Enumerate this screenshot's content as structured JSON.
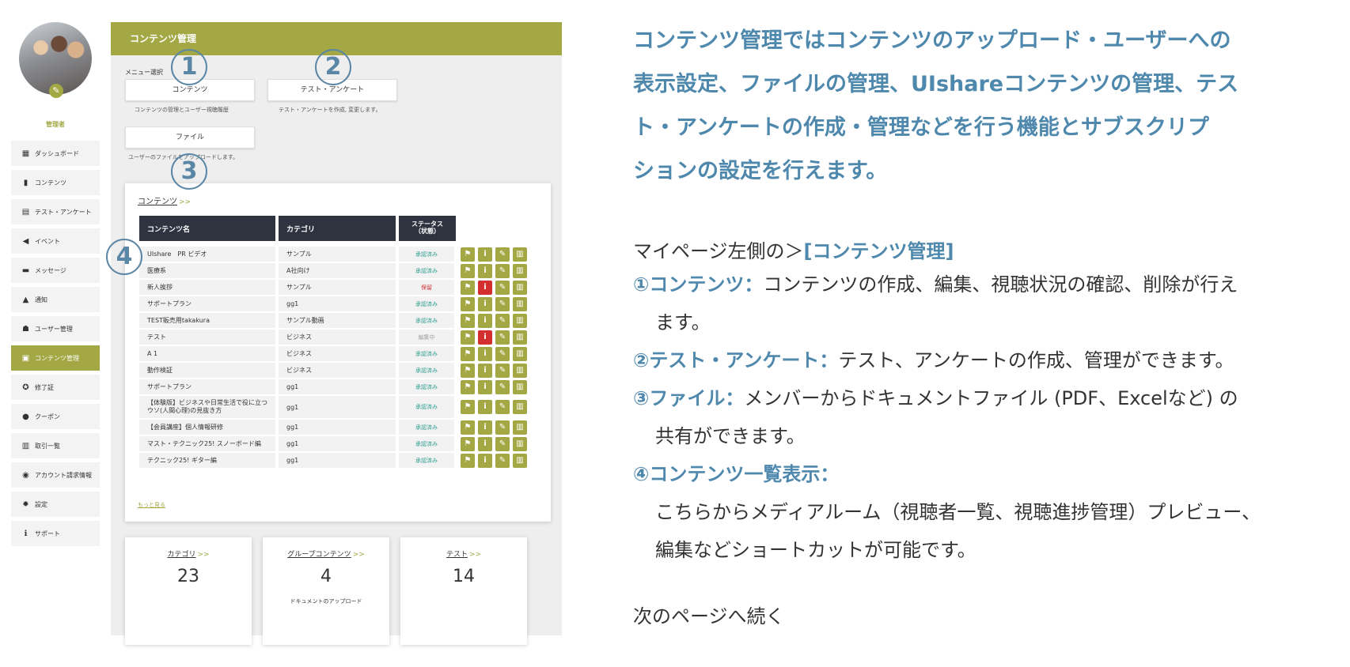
{
  "sidebar": {
    "role": "管理者",
    "items": [
      {
        "label": "ダッシュボード",
        "icon": "dashboard-icon",
        "glyph": "▦",
        "active": false
      },
      {
        "label": "コンテンツ",
        "icon": "book-icon",
        "glyph": "▮",
        "active": false
      },
      {
        "label": "テスト・アンケート",
        "icon": "test-icon",
        "glyph": "▤",
        "active": false
      },
      {
        "label": "イベント",
        "icon": "megaphone-icon",
        "glyph": "◀",
        "active": false
      },
      {
        "label": "メッセージ",
        "icon": "message-icon",
        "glyph": "▬",
        "active": false
      },
      {
        "label": "通知",
        "icon": "bell-icon",
        "glyph": "▲",
        "active": false
      },
      {
        "label": "ユーザー管理",
        "icon": "users-icon",
        "glyph": "☗",
        "active": false
      },
      {
        "label": "コンテンツ管理",
        "icon": "content-manage-icon",
        "glyph": "▣",
        "active": true
      },
      {
        "label": "修了証",
        "icon": "medal-icon",
        "glyph": "✪",
        "active": false
      },
      {
        "label": "クーポン",
        "icon": "coupon-icon",
        "glyph": "●",
        "active": false
      },
      {
        "label": "取引一覧",
        "icon": "transactions-icon",
        "glyph": "▥",
        "active": false
      },
      {
        "label": "アカウント請求情報",
        "icon": "billing-icon",
        "glyph": "◉",
        "active": false
      },
      {
        "label": "設定",
        "icon": "gear-icon",
        "glyph": "✹",
        "active": false
      },
      {
        "label": "サポート",
        "icon": "info-icon",
        "glyph": "ℹ",
        "active": false
      }
    ]
  },
  "panel": {
    "title": "コンテンツ管理",
    "menu_caption": "メニュー選択",
    "menu": {
      "contents": {
        "label": "コンテンツ",
        "desc": "コンテンツの管理とユーザー視聴履歴"
      },
      "test": {
        "label": "テスト・アンケート",
        "desc": "テスト・アンケートを作成, 変更します。"
      },
      "file": {
        "label": "ファイル",
        "desc": "ユーザーのファイルをアップロードします。"
      }
    },
    "content_card": {
      "title": "コンテンツ",
      "arrow": ">>",
      "headers": {
        "name": "コンテンツ名",
        "category": "カテゴリ",
        "status": "ステータス\n（状態）"
      },
      "more_label": "もっと見る"
    },
    "stats": [
      {
        "title": "カテゴリ",
        "value": "23",
        "sub": ""
      },
      {
        "title": "グループコンテンツ",
        "value": "4",
        "sub": "ドキュメントのアップロード"
      },
      {
        "title": "テスト",
        "value": "14",
        "sub": ""
      }
    ]
  },
  "rows": [
    {
      "name": "UIshare　PR ビデオ",
      "category": "サンプル",
      "status": "承認済み",
      "status_color": "#2a9d8f",
      "info_red": false
    },
    {
      "name": "医療系",
      "category": "A社向け",
      "status": "承認済み",
      "status_color": "#2a9d8f",
      "info_red": false
    },
    {
      "name": "新人挨拶",
      "category": "サンプル",
      "status": "保留",
      "status_color": "#d32f2f",
      "info_red": true
    },
    {
      "name": "サポートプラン",
      "category": "gg1",
      "status": "承認済み",
      "status_color": "#2a9d8f",
      "info_red": false
    },
    {
      "name": "TEST販売用takakura",
      "category": "サンプル動画",
      "status": "承認済み",
      "status_color": "#2a9d8f",
      "info_red": false
    },
    {
      "name": "テスト",
      "category": "ビジネス",
      "status": "編集中",
      "status_color": "#9e9e9e",
      "info_red": true
    },
    {
      "name": "A 1",
      "category": "ビジネス",
      "status": "承認済み",
      "status_color": "#2a9d8f",
      "info_red": false
    },
    {
      "name": "動作検証",
      "category": "ビジネス",
      "status": "承認済み",
      "status_color": "#2a9d8f",
      "info_red": false
    },
    {
      "name": "サポートプラン",
      "category": "gg1",
      "status": "承認済み",
      "status_color": "#2a9d8f",
      "info_red": false
    },
    {
      "name": "【体験版】ビジネスや日常生活で役に立つ　ウソ(人間心理)の見抜き方",
      "category": "gg1",
      "status": "承認済み",
      "status_color": "#2a9d8f",
      "info_red": false,
      "tall": true
    },
    {
      "name": "【会員講座】個人情報研修",
      "category": "gg1",
      "status": "承認済み",
      "status_color": "#2a9d8f",
      "info_red": false
    },
    {
      "name": "マスト・テクニック25! スノーボード編",
      "category": "gg1",
      "status": "承認済み",
      "status_color": "#2a9d8f",
      "info_red": false
    },
    {
      "name": "テクニック25! ギター編",
      "category": "gg1",
      "status": "承認済み",
      "status_color": "#2a9d8f",
      "info_red": false
    }
  ],
  "markers": [
    "1",
    "2",
    "3",
    "4"
  ],
  "explanation": {
    "lead_lines": [
      "コンテンツ管理ではコンテンツのアップロード・ユーザーへの",
      "表示設定、ファイルの管理、UIshareコンテンツの管理、テス",
      "ト・アンケートの作成・管理などを行う機能とサブスクリプ",
      "ションの設定を行えます。"
    ],
    "intro_prefix": "マイページ左側の＞",
    "intro_bold": "[コンテンツ管理]",
    "item1_bold": "①コンテンツ：",
    "item1_text": "コンテンツの作成、編集、視聴状況の確認、削除が行え",
    "item1_cont": "ます。",
    "item2_bold": "②テスト・アンケート：",
    "item2_text": "テスト、アンケートの作成、管理ができます。",
    "item3_bold": "③ファイル：",
    "item3_text": "メンバーからドキュメントファイル (PDF、Excelなど) の",
    "item3_cont": "共有ができます。",
    "item4_bold": "④コンテンツ一覧表示：",
    "item4_line1": "こちらからメディアルーム（視聴者一覧、視聴進捗管理）プレビュー、",
    "item4_line2": "編集などショートカットが可能です。",
    "continue": "次のページへ続く"
  }
}
